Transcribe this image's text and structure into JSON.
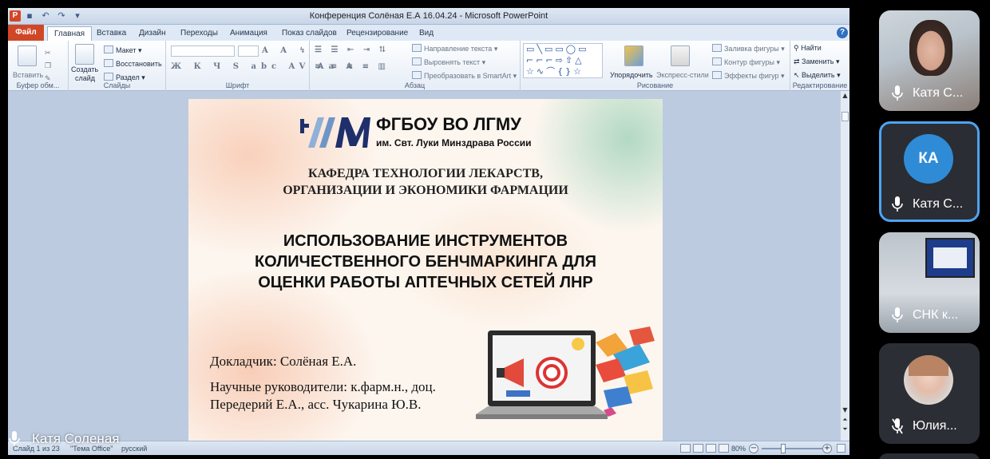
{
  "powerpoint": {
    "window_title": "Конференция Солёная Е.А 16.04.24  -  Microsoft PowerPoint",
    "app_icon_letter": "P",
    "tabs": [
      {
        "label": "Файл"
      },
      {
        "label": "Главная"
      },
      {
        "label": "Вставка"
      },
      {
        "label": "Дизайн"
      },
      {
        "label": "Переходы"
      },
      {
        "label": "Анимация"
      },
      {
        "label": "Показ слайдов"
      },
      {
        "label": "Рецензирование"
      },
      {
        "label": "Вид"
      }
    ],
    "active_tab": "Главная",
    "ribbon": {
      "clipboard": {
        "paste": "Вставить",
        "group": "Буфер обм..."
      },
      "slides": {
        "create": "Создать",
        "slide": "слайд",
        "layout": "Макет",
        "reset": "Восстановить",
        "section": "Раздел",
        "group": "Слайды"
      },
      "font": {
        "group": "Шрифт"
      },
      "paragraph": {
        "text_direction": "Направление текста",
        "align_text": "Выровнять текст",
        "smartart": "Преобразовать в SmartArt",
        "group": "Абзац"
      },
      "drawing": {
        "arrange": "Упорядочить",
        "quick_styles": "Экспресс-стили",
        "fill": "Заливка фигуры",
        "outline": "Контур фигуры",
        "effects": "Эффекты фигур",
        "group": "Рисование"
      },
      "editing": {
        "find": "Найти",
        "replace": "Заменить",
        "select": "Выделить",
        "group": "Редактирование"
      }
    },
    "slide": {
      "org_name": "ФГБОУ ВО ЛГМУ",
      "org_sub": "им. Свт. Луки Минздрава России",
      "dept_lines": [
        "КАФЕДРА ТЕХНОЛОГИИ ЛЕКАРСТВ,",
        "ОРГАНИЗАЦИИ И ЭКОНОМИКИ ФАРМАЦИИ"
      ],
      "title_lines": [
        "ИСПОЛЬЗОВАНИЕ ИНСТРУМЕНТОВ",
        "КОЛИЧЕСТВЕННОГО БЕНЧМАРКИНГА ДЛЯ",
        "ОЦЕНКИ РАБОТЫ АПТЕЧНЫХ СЕТЕЙ ЛНР"
      ],
      "speaker": "Докладчик: Солёная Е.А.",
      "advisors_lines": [
        "Научные руководители: к.фарм.н., доц.",
        "Передерий Е.А., асс. Чукарина Ю.В."
      ]
    },
    "status": {
      "slide_info": "Слайд 1 из 23",
      "theme": "\"Тема Office\"",
      "language": "русский",
      "zoom": "80%"
    }
  },
  "presenter": {
    "name": "Катя Соленая",
    "mic_state": "on"
  },
  "participants": [
    {
      "name": "Катя С...",
      "type": "video",
      "mic": "on"
    },
    {
      "name": "Катя С...",
      "type": "initials",
      "initials": "КА",
      "mic": "on",
      "active": true
    },
    {
      "name": "СНК к...",
      "type": "video",
      "mic": "on"
    },
    {
      "name": "Юлия...",
      "type": "photo",
      "mic": "off"
    }
  ],
  "colors": {
    "accent": "#4ea3f1",
    "avatar_blue": "#2f8bd6",
    "file_tab": "#d04727"
  }
}
